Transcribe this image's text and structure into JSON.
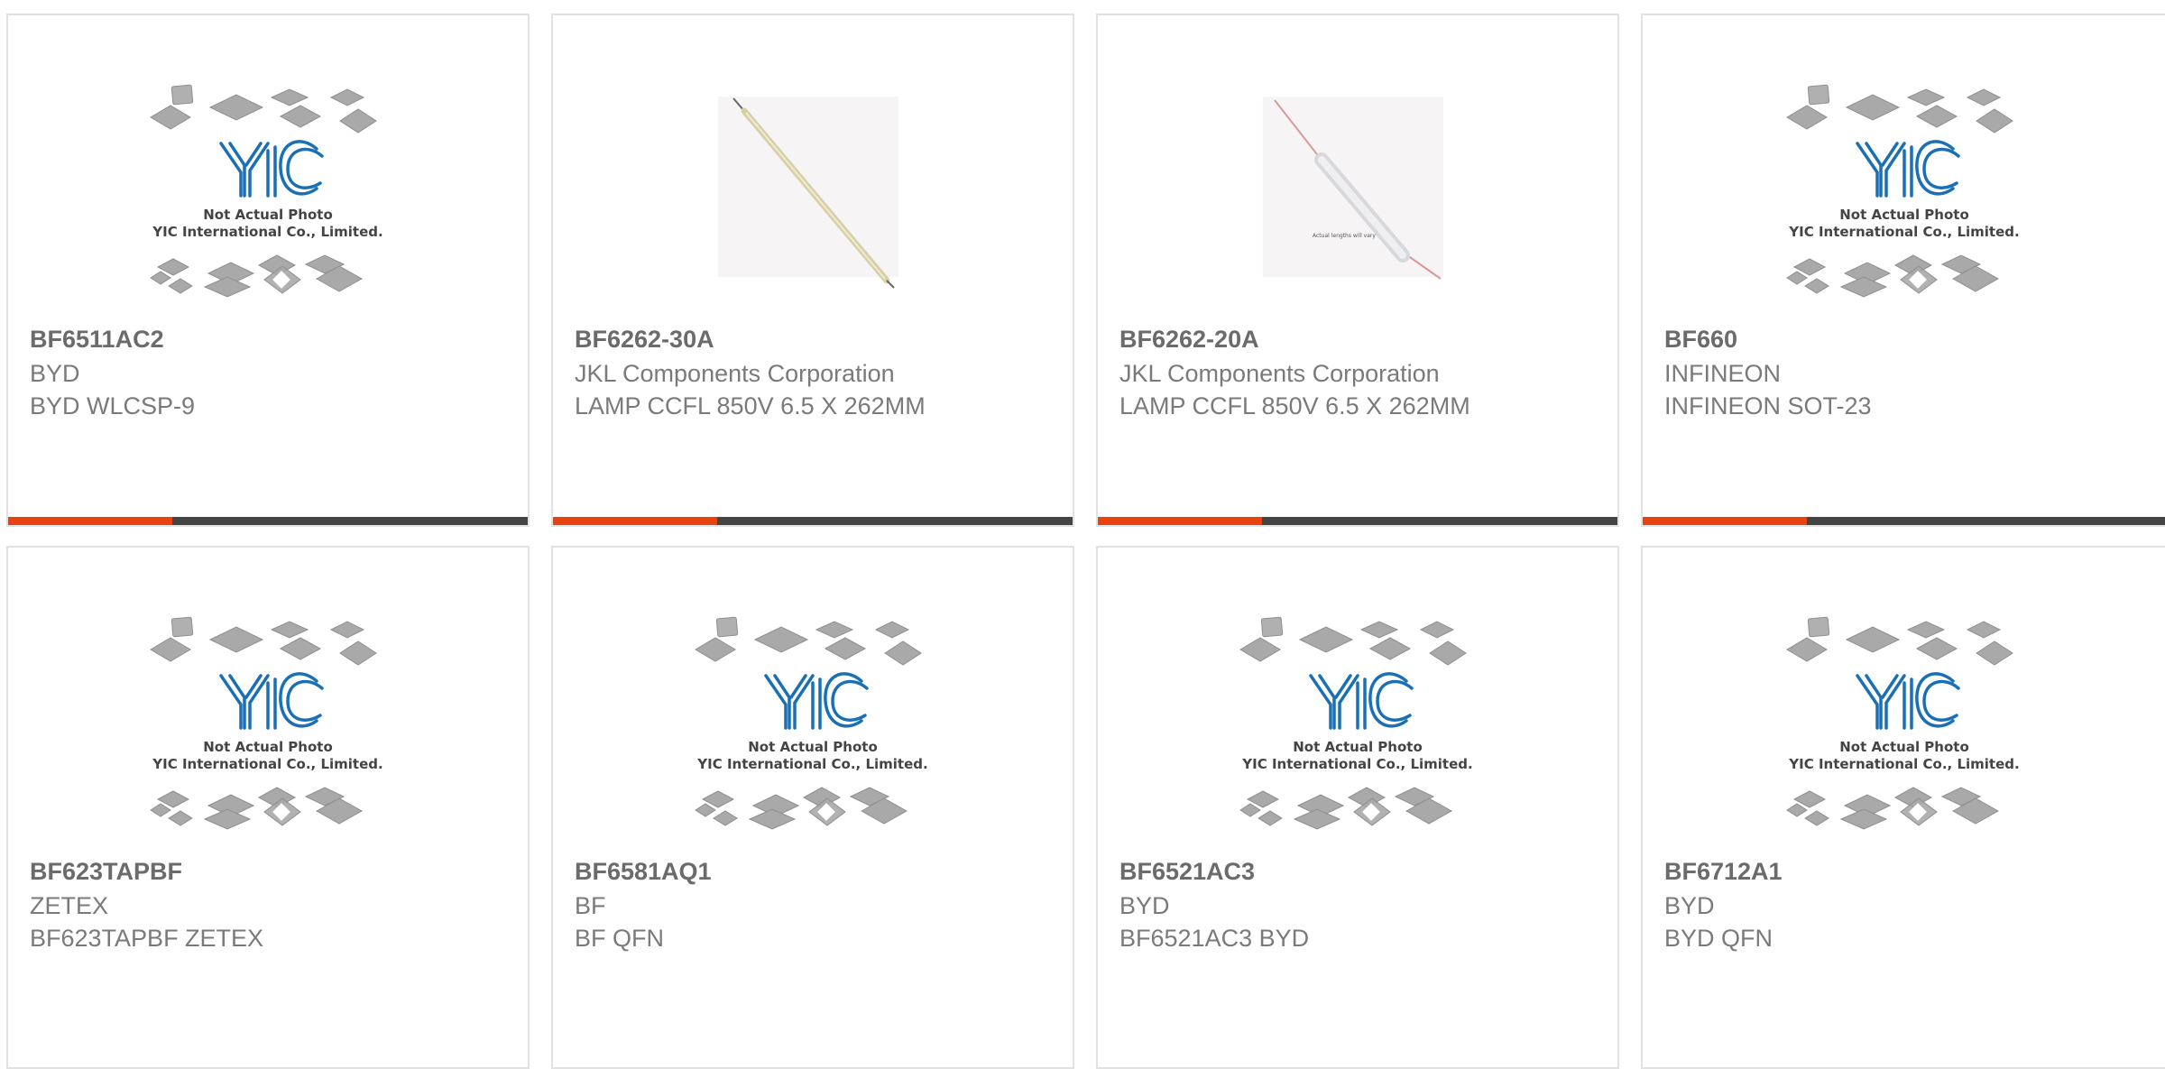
{
  "placeholder": {
    "line1": "Not Actual Photo",
    "line2": "YIC International Co., Limited.",
    "logo_text": "YIC"
  },
  "lamp_caption": "Actual lengths will vary",
  "colors": {
    "accent": "#e8420f",
    "bar": "#444444",
    "logo": "#1a6fb5",
    "card_border": "#e2e2e2"
  },
  "products": [
    {
      "part": "BF6511AC2",
      "manufacturer": "BYD",
      "description": "BYD WLCSP-9",
      "image": "yic-placeholder"
    },
    {
      "part": "BF6262-30A",
      "manufacturer": "JKL Components Corporation",
      "description": "LAMP CCFL 850V 6.5 X 262MM",
      "image": "ccfl-lamp"
    },
    {
      "part": "BF6262-20A",
      "manufacturer": "JKL Components Corporation",
      "description": "LAMP CCFL 850V 6.5 X 262MM",
      "image": "ccfl-lamp-with-wires"
    },
    {
      "part": "BF660",
      "manufacturer": "INFINEON",
      "description": "INFINEON SOT-23",
      "image": "yic-placeholder"
    },
    {
      "part": "BF623TAPBF",
      "manufacturer": "ZETEX",
      "description": "BF623TAPBF ZETEX",
      "image": "yic-placeholder"
    },
    {
      "part": "BF6581AQ1",
      "manufacturer": "BF",
      "description": "BF QFN",
      "image": "yic-placeholder"
    },
    {
      "part": "BF6521AC3",
      "manufacturer": "BYD",
      "description": "BF6521AC3 BYD",
      "image": "yic-placeholder"
    },
    {
      "part": "BF6712A1",
      "manufacturer": "BYD",
      "description": "BYD QFN",
      "image": "yic-placeholder"
    }
  ]
}
